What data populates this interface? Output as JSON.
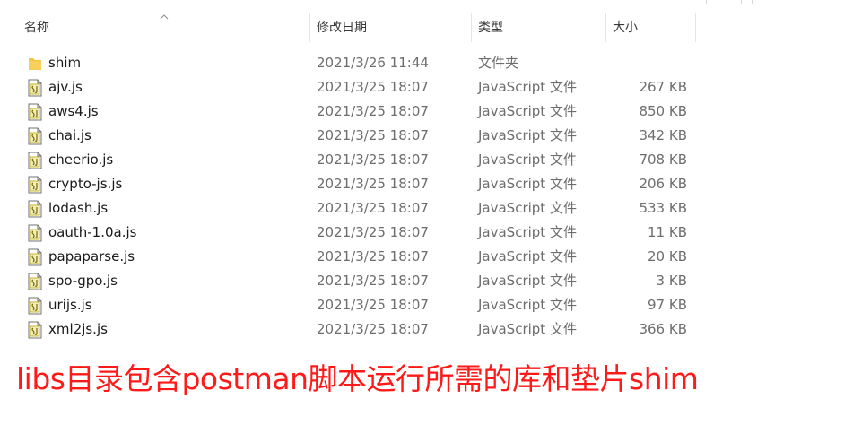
{
  "columns": {
    "name": "名称",
    "date": "修改日期",
    "type": "类型",
    "size": "大小"
  },
  "files": [
    {
      "name": "shim",
      "date": "2021/3/26 11:44",
      "type": "文件夹",
      "size": "",
      "icon": "folder-icon"
    },
    {
      "name": "ajv.js",
      "date": "2021/3/25 18:07",
      "type": "JavaScript 文件",
      "size": "267 KB",
      "icon": "js-file-icon"
    },
    {
      "name": "aws4.js",
      "date": "2021/3/25 18:07",
      "type": "JavaScript 文件",
      "size": "850 KB",
      "icon": "js-file-icon"
    },
    {
      "name": "chai.js",
      "date": "2021/3/25 18:07",
      "type": "JavaScript 文件",
      "size": "342 KB",
      "icon": "js-file-icon"
    },
    {
      "name": "cheerio.js",
      "date": "2021/3/25 18:07",
      "type": "JavaScript 文件",
      "size": "708 KB",
      "icon": "js-file-icon"
    },
    {
      "name": "crypto-js.js",
      "date": "2021/3/25 18:07",
      "type": "JavaScript 文件",
      "size": "206 KB",
      "icon": "js-file-icon"
    },
    {
      "name": "lodash.js",
      "date": "2021/3/25 18:07",
      "type": "JavaScript 文件",
      "size": "533 KB",
      "icon": "js-file-icon"
    },
    {
      "name": "oauth-1.0a.js",
      "date": "2021/3/25 18:07",
      "type": "JavaScript 文件",
      "size": "11 KB",
      "icon": "js-file-icon"
    },
    {
      "name": "papaparse.js",
      "date": "2021/3/25 18:07",
      "type": "JavaScript 文件",
      "size": "20 KB",
      "icon": "js-file-icon"
    },
    {
      "name": "spo-gpo.js",
      "date": "2021/3/25 18:07",
      "type": "JavaScript 文件",
      "size": "3 KB",
      "icon": "js-file-icon"
    },
    {
      "name": "urijs.js",
      "date": "2021/3/25 18:07",
      "type": "JavaScript 文件",
      "size": "97 KB",
      "icon": "js-file-icon"
    },
    {
      "name": "xml2js.js",
      "date": "2021/3/25 18:07",
      "type": "JavaScript 文件",
      "size": "366 KB",
      "icon": "js-file-icon"
    }
  ],
  "caption": "libs目录包含postman脚本运行所需的库和垫片shim",
  "colors": {
    "caption": "#ff1a1a",
    "folder": "#f5c342",
    "js_icon_accent": "#c8b400"
  }
}
